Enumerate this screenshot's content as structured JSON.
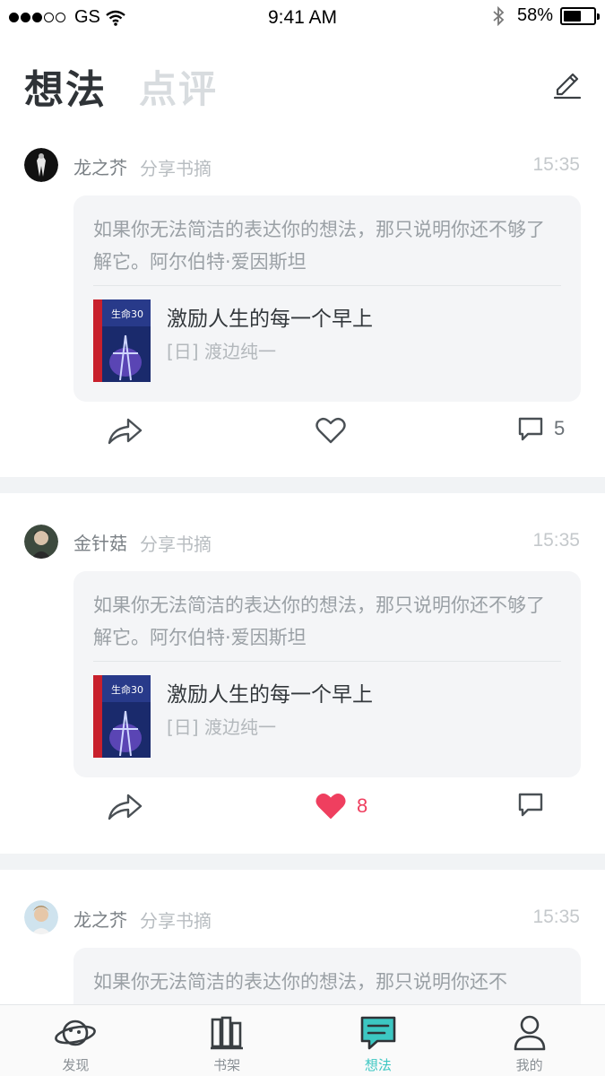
{
  "status_bar": {
    "carrier": "GS",
    "time": "9:41 AM",
    "battery": "58%",
    "battery_level": 0.58
  },
  "header": {
    "tab_active": "想法",
    "tab_inactive": "点评",
    "edit_icon": "edit-pen-icon"
  },
  "posts": [
    {
      "username": "龙之芥",
      "action": "分享书摘",
      "time": "15:35",
      "quote": "如果你无法简洁的表达你的想法，那只说明你还不够了解它。阿尔伯特·爱因斯坦",
      "book_title": "激励人生的每一个早上",
      "book_author": "[日] 渡边纯一",
      "liked": false,
      "like_count": "",
      "comment_count": "5"
    },
    {
      "username": "金针菇",
      "action": "分享书摘",
      "time": "15:35",
      "quote": "如果你无法简洁的表达你的想法，那只说明你还不够了解它。阿尔伯特·爱因斯坦",
      "book_title": "激励人生的每一个早上",
      "book_author": "[日] 渡边纯一",
      "liked": true,
      "like_count": "8",
      "comment_count": ""
    },
    {
      "username": "龙之芥",
      "action": "分享书摘",
      "time": "15:35",
      "quote": "如果你无法简洁的表达你的想法，那只说明你还不"
    }
  ],
  "tabbar": {
    "items": [
      {
        "label": "发现",
        "icon": "planet-icon"
      },
      {
        "label": "书架",
        "icon": "bookshelf-icon"
      },
      {
        "label": "想法",
        "icon": "chat-icon",
        "active": true
      },
      {
        "label": "我的",
        "icon": "person-icon"
      }
    ]
  },
  "colors": {
    "accent": "#3cc7c2",
    "like": "#ef3f5f",
    "separator": "#f1f3f5"
  }
}
